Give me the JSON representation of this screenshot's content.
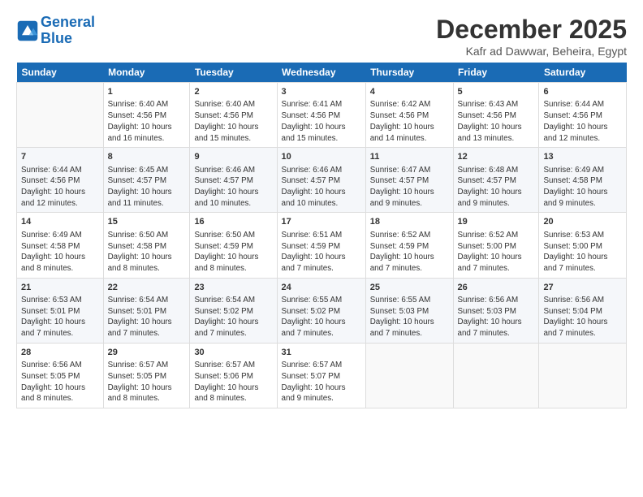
{
  "logo": {
    "line1": "General",
    "line2": "Blue"
  },
  "title": "December 2025",
  "subtitle": "Kafr ad Dawwar, Beheira, Egypt",
  "days_header": [
    "Sunday",
    "Monday",
    "Tuesday",
    "Wednesday",
    "Thursday",
    "Friday",
    "Saturday"
  ],
  "weeks": [
    [
      {
        "num": "",
        "info": ""
      },
      {
        "num": "1",
        "info": "Sunrise: 6:40 AM\nSunset: 4:56 PM\nDaylight: 10 hours\nand 16 minutes."
      },
      {
        "num": "2",
        "info": "Sunrise: 6:40 AM\nSunset: 4:56 PM\nDaylight: 10 hours\nand 15 minutes."
      },
      {
        "num": "3",
        "info": "Sunrise: 6:41 AM\nSunset: 4:56 PM\nDaylight: 10 hours\nand 15 minutes."
      },
      {
        "num": "4",
        "info": "Sunrise: 6:42 AM\nSunset: 4:56 PM\nDaylight: 10 hours\nand 14 minutes."
      },
      {
        "num": "5",
        "info": "Sunrise: 6:43 AM\nSunset: 4:56 PM\nDaylight: 10 hours\nand 13 minutes."
      },
      {
        "num": "6",
        "info": "Sunrise: 6:44 AM\nSunset: 4:56 PM\nDaylight: 10 hours\nand 12 minutes."
      }
    ],
    [
      {
        "num": "7",
        "info": "Sunrise: 6:44 AM\nSunset: 4:56 PM\nDaylight: 10 hours\nand 12 minutes."
      },
      {
        "num": "8",
        "info": "Sunrise: 6:45 AM\nSunset: 4:57 PM\nDaylight: 10 hours\nand 11 minutes."
      },
      {
        "num": "9",
        "info": "Sunrise: 6:46 AM\nSunset: 4:57 PM\nDaylight: 10 hours\nand 10 minutes."
      },
      {
        "num": "10",
        "info": "Sunrise: 6:46 AM\nSunset: 4:57 PM\nDaylight: 10 hours\nand 10 minutes."
      },
      {
        "num": "11",
        "info": "Sunrise: 6:47 AM\nSunset: 4:57 PM\nDaylight: 10 hours\nand 9 minutes."
      },
      {
        "num": "12",
        "info": "Sunrise: 6:48 AM\nSunset: 4:57 PM\nDaylight: 10 hours\nand 9 minutes."
      },
      {
        "num": "13",
        "info": "Sunrise: 6:49 AM\nSunset: 4:58 PM\nDaylight: 10 hours\nand 9 minutes."
      }
    ],
    [
      {
        "num": "14",
        "info": "Sunrise: 6:49 AM\nSunset: 4:58 PM\nDaylight: 10 hours\nand 8 minutes."
      },
      {
        "num": "15",
        "info": "Sunrise: 6:50 AM\nSunset: 4:58 PM\nDaylight: 10 hours\nand 8 minutes."
      },
      {
        "num": "16",
        "info": "Sunrise: 6:50 AM\nSunset: 4:59 PM\nDaylight: 10 hours\nand 8 minutes."
      },
      {
        "num": "17",
        "info": "Sunrise: 6:51 AM\nSunset: 4:59 PM\nDaylight: 10 hours\nand 7 minutes."
      },
      {
        "num": "18",
        "info": "Sunrise: 6:52 AM\nSunset: 4:59 PM\nDaylight: 10 hours\nand 7 minutes."
      },
      {
        "num": "19",
        "info": "Sunrise: 6:52 AM\nSunset: 5:00 PM\nDaylight: 10 hours\nand 7 minutes."
      },
      {
        "num": "20",
        "info": "Sunrise: 6:53 AM\nSunset: 5:00 PM\nDaylight: 10 hours\nand 7 minutes."
      }
    ],
    [
      {
        "num": "21",
        "info": "Sunrise: 6:53 AM\nSunset: 5:01 PM\nDaylight: 10 hours\nand 7 minutes."
      },
      {
        "num": "22",
        "info": "Sunrise: 6:54 AM\nSunset: 5:01 PM\nDaylight: 10 hours\nand 7 minutes."
      },
      {
        "num": "23",
        "info": "Sunrise: 6:54 AM\nSunset: 5:02 PM\nDaylight: 10 hours\nand 7 minutes."
      },
      {
        "num": "24",
        "info": "Sunrise: 6:55 AM\nSunset: 5:02 PM\nDaylight: 10 hours\nand 7 minutes."
      },
      {
        "num": "25",
        "info": "Sunrise: 6:55 AM\nSunset: 5:03 PM\nDaylight: 10 hours\nand 7 minutes."
      },
      {
        "num": "26",
        "info": "Sunrise: 6:56 AM\nSunset: 5:03 PM\nDaylight: 10 hours\nand 7 minutes."
      },
      {
        "num": "27",
        "info": "Sunrise: 6:56 AM\nSunset: 5:04 PM\nDaylight: 10 hours\nand 7 minutes."
      }
    ],
    [
      {
        "num": "28",
        "info": "Sunrise: 6:56 AM\nSunset: 5:05 PM\nDaylight: 10 hours\nand 8 minutes."
      },
      {
        "num": "29",
        "info": "Sunrise: 6:57 AM\nSunset: 5:05 PM\nDaylight: 10 hours\nand 8 minutes."
      },
      {
        "num": "30",
        "info": "Sunrise: 6:57 AM\nSunset: 5:06 PM\nDaylight: 10 hours\nand 8 minutes."
      },
      {
        "num": "31",
        "info": "Sunrise: 6:57 AM\nSunset: 5:07 PM\nDaylight: 10 hours\nand 9 minutes."
      },
      {
        "num": "",
        "info": ""
      },
      {
        "num": "",
        "info": ""
      },
      {
        "num": "",
        "info": ""
      }
    ]
  ]
}
